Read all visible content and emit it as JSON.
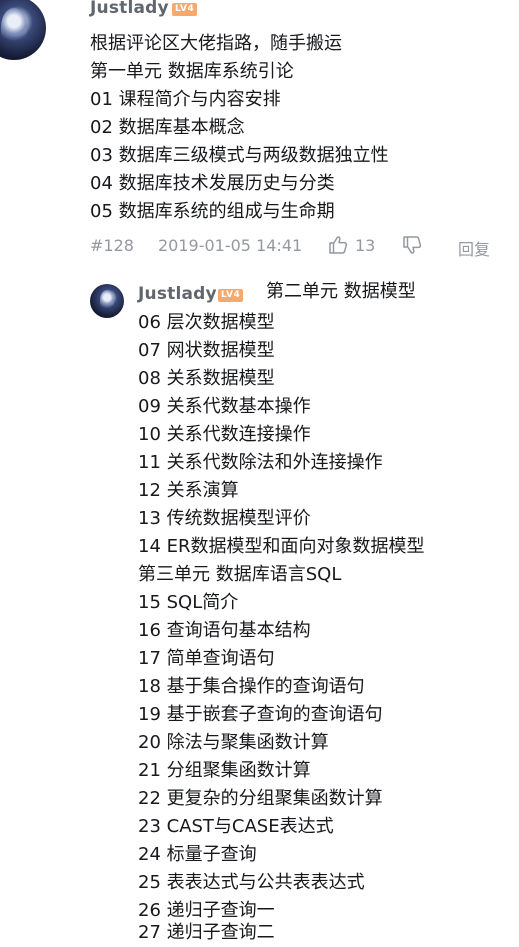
{
  "comment1": {
    "user": "Justlady",
    "level": "LV4",
    "lines": [
      "根据评论区大佬指路，随手搬运",
      "第一单元 数据库系统引论",
      "01 课程简介与内容安排",
      "02 数据库基本概念",
      "03 数据库三级模式与两级数据独立性",
      "04 数据库技术发展历史与分类",
      "05 数据库系统的组成与生命期"
    ],
    "floor": "#128",
    "date": "2019-01-05 14:41",
    "likes": "13",
    "reply_label": "回复"
  },
  "reply1": {
    "user": "Justlady",
    "level": "LV4",
    "first_line": "第二单元 数据模型",
    "lines": [
      "06 层次数据模型",
      "07 网状数据模型",
      "08 关系数据模型",
      "09 关系代数基本操作",
      "10 关系代数连接操作",
      "11 关系代数除法和外连接操作",
      "12 关系演算",
      "13 传统数据模型评价",
      "14 ER数据模型和面向对象数据模型",
      "第三单元 数据库语言SQL",
      "15 SQL简介",
      "16 查询语句基本结构",
      "17 简单查询语句",
      "18 基于集合操作的查询语句",
      "19 基于嵌套子查询的查询语句",
      "20 除法与聚集函数计算",
      "21 分组聚集函数计算",
      "22 更复杂的分组聚集函数计算",
      "23 CAST与CASE表达式",
      "24 标量子查询",
      "25 表表达式与公共表表达式",
      "26 递归子查询一",
      "27 递归子查询二"
    ]
  },
  "colors": {
    "level_badge": "#f6a86d",
    "meta_gray": "#9499a0",
    "username_gray": "#61666d",
    "text": "#18191c"
  },
  "icons": [
    "thumbs-up-icon",
    "thumbs-down-icon"
  ]
}
